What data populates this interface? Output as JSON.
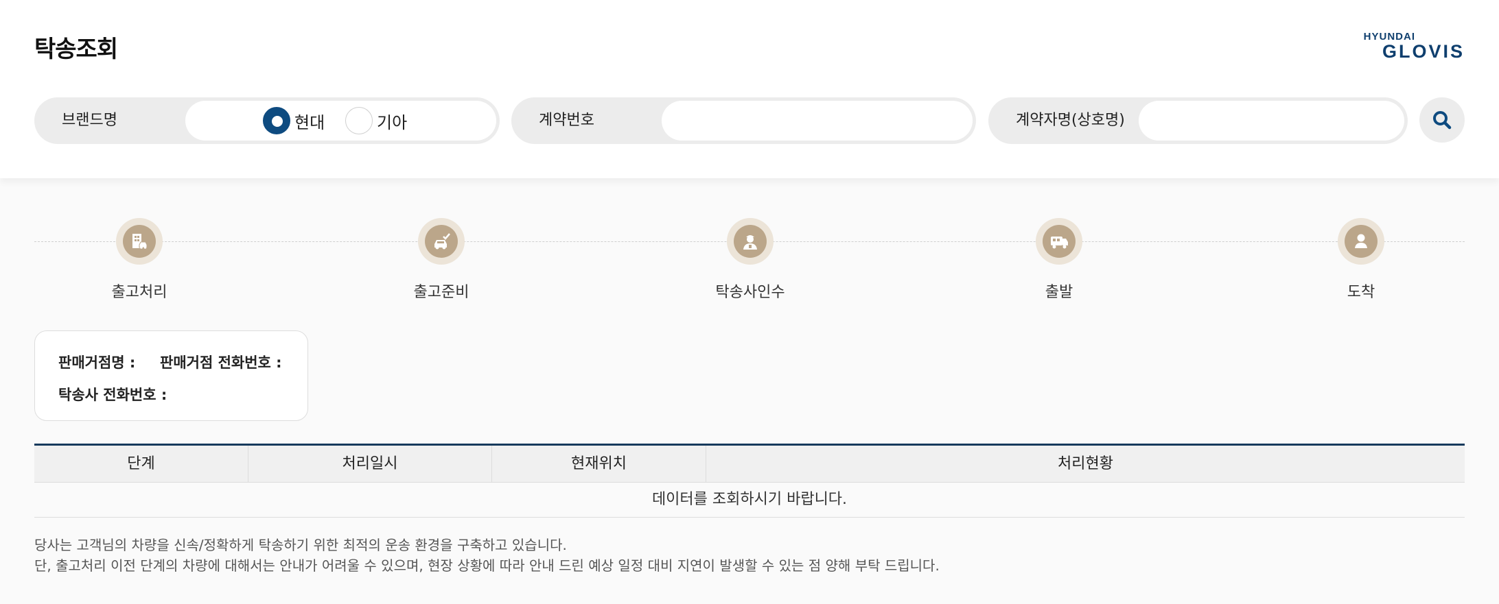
{
  "page": {
    "title": "탁송조회"
  },
  "logo": {
    "line1": "HYUNDAI",
    "line2": "GLOVIS"
  },
  "search": {
    "brand_label": "브랜드명",
    "brand_options": [
      {
        "label": "현대",
        "selected": true
      },
      {
        "label": "기아",
        "selected": false
      }
    ],
    "contract_no_label": "계약번호",
    "contract_no_value": "",
    "contractor_label": "계약자명(상호명)",
    "contractor_value": "",
    "search_icon": "search-icon"
  },
  "steps": [
    {
      "label": "출고처리",
      "icon": "building-car-icon"
    },
    {
      "label": "출고준비",
      "icon": "car-check-icon"
    },
    {
      "label": "탁송사인수",
      "icon": "driver-icon"
    },
    {
      "label": "출발",
      "icon": "truck-icon"
    },
    {
      "label": "도착",
      "icon": "person-icon"
    }
  ],
  "info": {
    "dealer_name_label": "판매거점명 :",
    "dealer_phone_label": "판매거점 전화번호 :",
    "carrier_phone_label": "탁송사 전화번호 :"
  },
  "table": {
    "headers": [
      "단계",
      "처리일시",
      "현재위치",
      "처리현황"
    ],
    "empty_message": "데이터를 조회하시기 바랍니다."
  },
  "notice": {
    "line1": "당사는 고객님의 차량을 신속/정확하게 탁송하기 위한 최적의 운송 환경을 구축하고 있습니다.",
    "line2": "단, 출고처리 이전 단계의 차량에 대해서는 안내가 어려울 수 있으며, 현장 상황에 따라 안내 드린 예상 일정 대비 지연이 발생할 수 있는 점 양해 부탁 드립니다."
  },
  "colors": {
    "accent": "#0e4b80",
    "step_icon": "#bba68a",
    "step_ring": "#ece4d8"
  }
}
